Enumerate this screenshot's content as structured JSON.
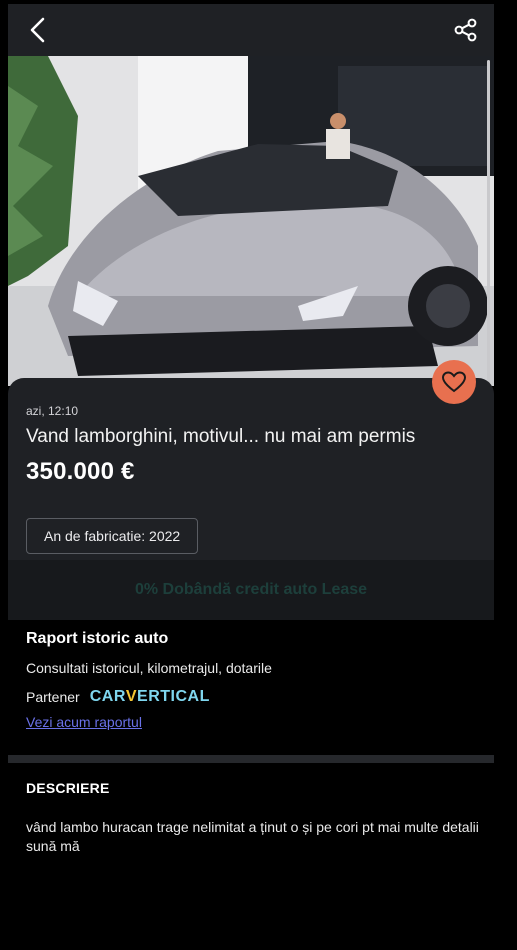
{
  "header": {
    "back_icon": "chevron-left-icon",
    "share_icon": "share-icon"
  },
  "listing": {
    "posted": "azi, 12:10",
    "title": "Vand lamborghini, motivul... nu mai am permis",
    "price": "350.000 €",
    "year_chip": "An de fabricatie: 2022",
    "favorite_icon": "heart-icon",
    "favorite_color": "#e8704f"
  },
  "credit_bar": {
    "label": "0% Dobândă credit auto Lease"
  },
  "report": {
    "title": "Raport istoric auto",
    "subtitle": "Consultati istoricul, kilometrajul, dotarile",
    "partner_label": "Partener",
    "partner_brand_a": "CAR",
    "partner_brand_b": "V",
    "partner_brand_c": "ERTICAL",
    "link": "Vezi acum raportul",
    "link_color": "#6a71e8"
  },
  "description": {
    "heading": "DESCRIERE",
    "text": "vând lambo huracan trage nelimitat a ținut o și pe cori pt mai multe detalii sună mă"
  }
}
